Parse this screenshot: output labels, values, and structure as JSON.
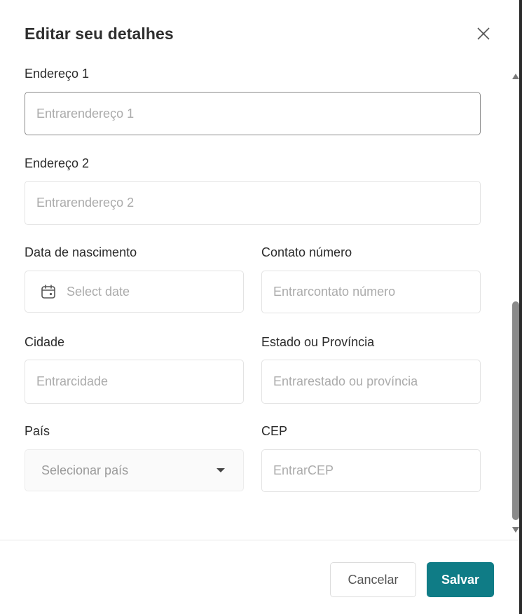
{
  "dialog": {
    "title": "Editar seu detalhes"
  },
  "fields": {
    "address1": {
      "label": "Endereço 1",
      "placeholder": "Entrarendereço 1",
      "value": ""
    },
    "address2": {
      "label": "Endereço 2",
      "placeholder": "Entrarendereço 2",
      "value": ""
    },
    "birthdate": {
      "label": "Data de nascimento",
      "placeholder": "Select date",
      "value": ""
    },
    "contact_number": {
      "label": "Contato número",
      "placeholder": "Entrarcontato número",
      "value": ""
    },
    "city": {
      "label": "Cidade",
      "placeholder": "Entrarcidade",
      "value": ""
    },
    "state": {
      "label": "Estado ou Província",
      "placeholder": "Entrarestado ou província",
      "value": ""
    },
    "country": {
      "label": "País",
      "placeholder": "Selecionar país",
      "value": ""
    },
    "zip": {
      "label": "CEP",
      "placeholder": "EntrarCEP",
      "value": ""
    }
  },
  "footer": {
    "cancel_label": "Cancelar",
    "save_label": "Salvar"
  },
  "colors": {
    "primary": "#0f7c86",
    "text": "#2b2b2b",
    "placeholder": "#ababab",
    "border": "#e3e3e3"
  },
  "icons": {
    "close": "close-icon",
    "calendar": "calendar-icon",
    "dropdown": "chevron-down-icon"
  }
}
